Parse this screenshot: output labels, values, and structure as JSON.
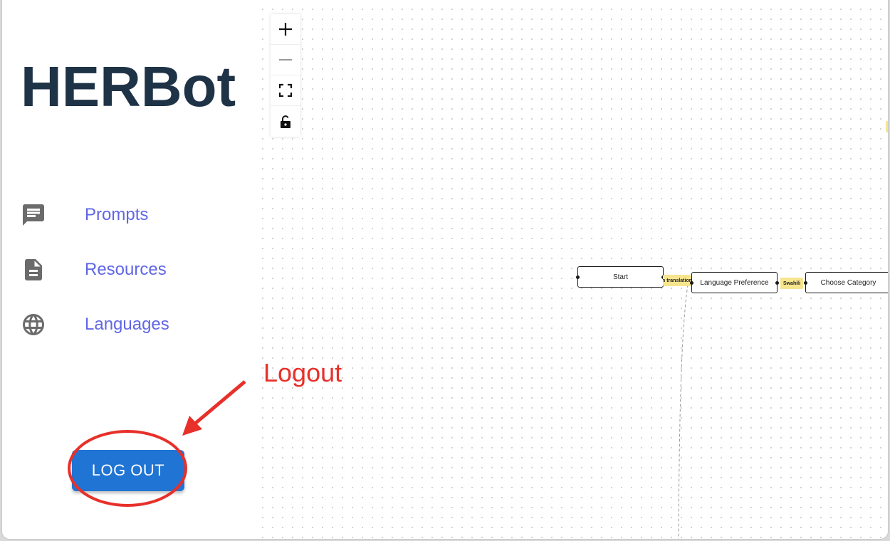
{
  "app": {
    "title": "HERBot"
  },
  "sidebar": {
    "items": [
      {
        "label": "Prompts",
        "icon": "chat-icon"
      },
      {
        "label": "Resources",
        "icon": "document-icon"
      },
      {
        "label": "Languages",
        "icon": "globe-icon"
      }
    ],
    "logout_label": "LOG OUT"
  },
  "canvas": {
    "controls": [
      "zoom-in-icon",
      "zoom-out-icon",
      "fit-view-icon",
      "lock-icon"
    ],
    "nodes": [
      "Start",
      "Language Preference",
      "Choose Category"
    ],
    "edge_labels": [
      "n translation",
      "Swahili"
    ]
  },
  "annotation": {
    "label": "Logout",
    "color": "#e8302a"
  },
  "colors": {
    "accent": "#1f74d4",
    "nav_text": "#6066e6",
    "title": "#1f3347"
  }
}
